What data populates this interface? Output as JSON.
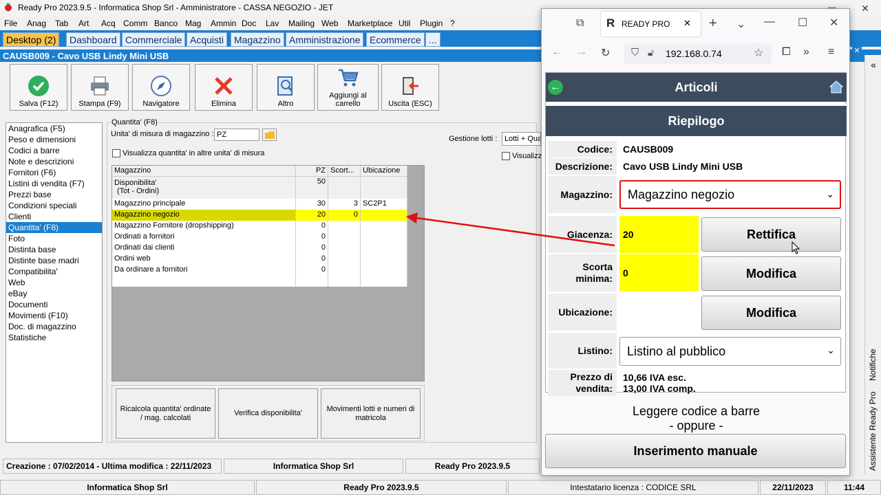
{
  "window": {
    "title": "Ready Pro 2023.9.5 - Informatica Shop Srl - Amministratore - CASSA NEGOZIO - JET"
  },
  "menu": [
    "File",
    "Anag",
    "Tab",
    "Art",
    "Acq",
    "Comm",
    "Banco",
    "Mag",
    "Ammin",
    "Doc",
    "Lav",
    "Mailing",
    "Web",
    "Marketplace",
    "Util",
    "Plugin",
    "?"
  ],
  "tabs": [
    "Desktop (2)",
    "Dashboard",
    "Commerciale",
    "Acquisti",
    "Magazzino",
    "Amministrazione",
    "Ecommerce",
    "..."
  ],
  "header": {
    "title": "CAUSB009 - Cavo USB Lindy Mini USB"
  },
  "toolbar": {
    "save": "Salva (F12)",
    "print": "Stampa (F9)",
    "navigator": "Navigatore",
    "delete": "Elimina",
    "other": "Altro",
    "cart": "Aggiungi al carrello",
    "exit": "Uscita (ESC)"
  },
  "left_list": [
    "Anagrafica (F5)",
    "Peso e dimensioni",
    "Codici a barre",
    "Note e descrizioni",
    "Fornitori (F6)",
    "Listini di vendita (F7)",
    "Prezzi base",
    "Condizioni speciali",
    "Clienti",
    "Quantita' (F8)",
    "Foto",
    "Distinta base",
    "Distinte base madri",
    "Compatibilita'",
    "Web",
    "eBay",
    "Documenti",
    "Movimenti (F10)",
    "Doc. di magazzino",
    "Statistiche"
  ],
  "qty": {
    "group": "Quantita' (F8)",
    "unit_label": "Unita' di misura di magazzino :",
    "unit_value": "PZ",
    "show_other_units": "Visualizza quantita' in altre unita' di misura",
    "lots_label": "Gestione lotti :",
    "lots_value": "Lotti + Qua",
    "visualizza": "Visualizz"
  },
  "grid": {
    "headers": [
      "Magazzino",
      "PZ",
      "Scort...",
      "Ubicazione"
    ],
    "rows": [
      {
        "name": "Disponibilita'",
        "name2": "(Tot - Ordini)",
        "pz": "50",
        "scorta": "",
        "ubic": ""
      },
      {
        "name": "Magazzino principale",
        "pz": "30",
        "scorta": "3",
        "ubic": "SC2P1"
      },
      {
        "name": "Magazzino negozio",
        "pz": "20",
        "scorta": "0",
        "ubic": ""
      },
      {
        "name": "Magazzino Fornitore (dropshipping)",
        "pz": "0",
        "scorta": "",
        "ubic": ""
      },
      {
        "name": "Ordinati a fornitori",
        "pz": "0",
        "scorta": "",
        "ubic": ""
      },
      {
        "name": "Ordinati dai clienti",
        "pz": "0",
        "scorta": "",
        "ubic": ""
      },
      {
        "name": "Ordini web",
        "pz": "0",
        "scorta": "",
        "ubic": ""
      },
      {
        "name": "Da ordinare a fornitori",
        "pz": "0",
        "scorta": "",
        "ubic": ""
      }
    ]
  },
  "bottom_buttons": {
    "recalc": "Ricalcola quantita' ordinate / mag. calcolati",
    "verify": "Verifica disponibilita'",
    "movements": "Movimenti lotti e numeri di matricola"
  },
  "status": {
    "dates": "Creazione : 07/02/2014 - Ultima modifica : 22/11/2023",
    "company": "Informatica Shop Srl",
    "version": "Ready Pro 2023.9.5"
  },
  "status2": {
    "company": "Informatica Shop Srl",
    "version": "Ready Pro 2023.9.5",
    "license": "Intestatario licenza : CODICE SRL",
    "date": "22/11/2023",
    "time": "11:44"
  },
  "browser": {
    "tab_title": "READY PRO",
    "url": "192.168.0.74"
  },
  "mobile": {
    "title": "Articoli",
    "subtitle": "Riepilogo",
    "code_label": "Codice:",
    "code": "CAUSB009",
    "desc_label": "Descrizione:",
    "desc": "Cavo USB Lindy Mini USB",
    "warehouse_label": "Magazzino:",
    "warehouse": "Magazzino negozio",
    "stock_label": "Giacenza:",
    "stock": "20",
    "adjust": "Rettifica",
    "min_label": "Scorta minima:",
    "min": "0",
    "modify1": "Modifica",
    "location_label": "Ubicazione:",
    "modify2": "Modifica",
    "list_label": "Listino:",
    "list": "Listino al pubblico",
    "price_label": "Prezzo di vendita:",
    "price1": "10,66 IVA esc.",
    "price2": "13,00 IVA comp.",
    "barcode1": "Leggere codice a barre",
    "barcode2": "- oppure -",
    "manual": "Inserimento manuale"
  },
  "sidebar": {
    "notifications": "Notifiche",
    "assistant": "Assistente Ready Pro"
  },
  "colors": {
    "accent": "#1b7fd0",
    "highlight": "#ffff00",
    "mobile_header": "#3c4b5d",
    "arrow": "#e01010"
  }
}
